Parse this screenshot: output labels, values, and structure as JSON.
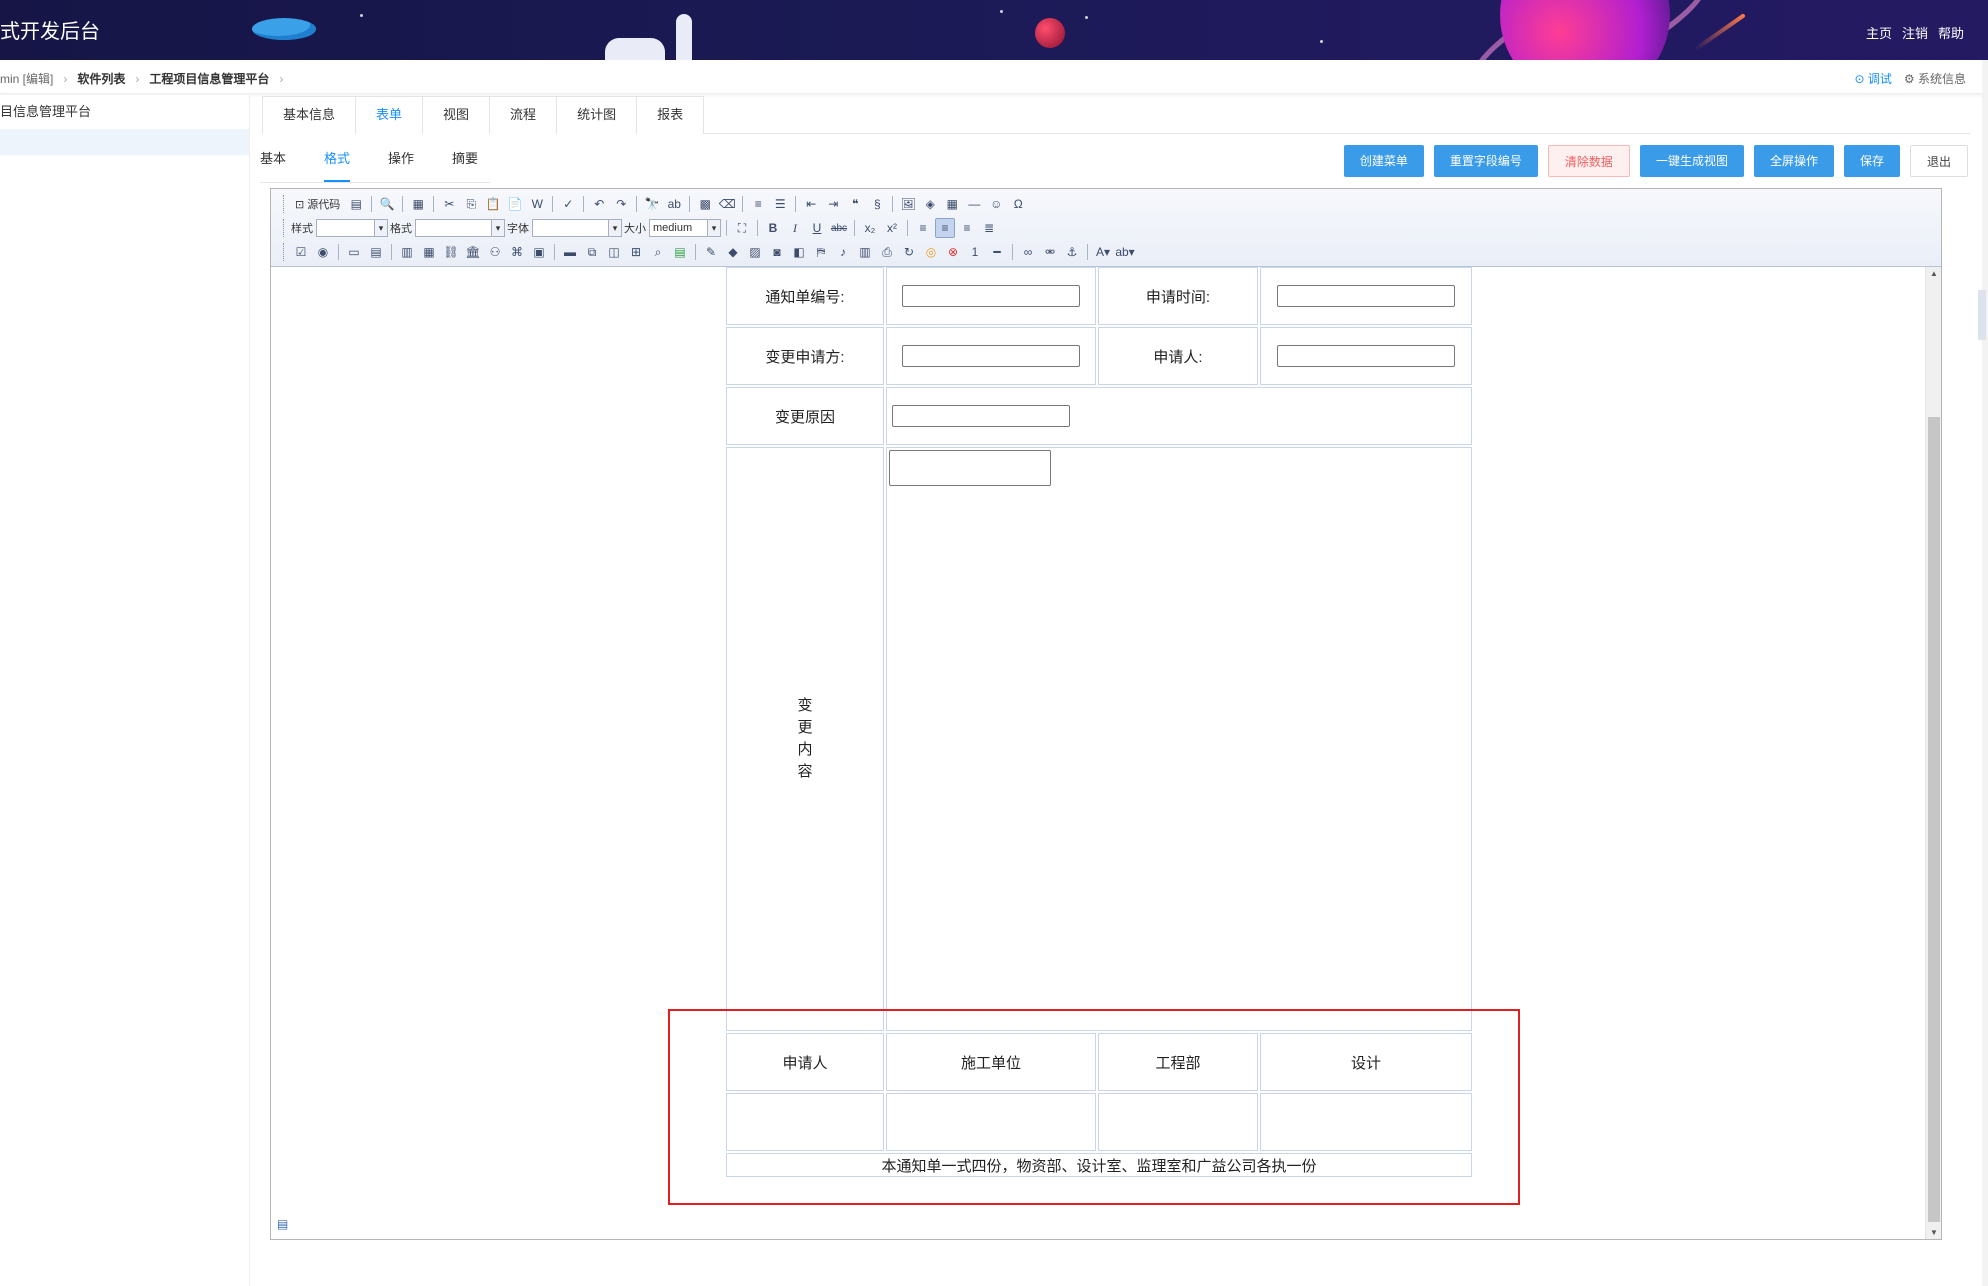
{
  "header": {
    "title": "式开发后台",
    "links": [
      "主页",
      "注销",
      "帮助"
    ]
  },
  "breadcrumb": {
    "user": "min [编辑]",
    "software_list": "软件列表",
    "platform": "工程项目信息管理平台",
    "debug": "⊙ 调试",
    "system_info": "⚙ 系统信息"
  },
  "sidebar": {
    "items": [
      {
        "label": "目信息管理平台"
      },
      {
        "label": ""
      }
    ]
  },
  "tabs": [
    {
      "label": "基本信息"
    },
    {
      "label": "表单"
    },
    {
      "label": "视图"
    },
    {
      "label": "流程"
    },
    {
      "label": "统计图"
    },
    {
      "label": "报表"
    }
  ],
  "subtabs": [
    {
      "label": "基本"
    },
    {
      "label": "格式"
    },
    {
      "label": "操作"
    },
    {
      "label": "摘要"
    }
  ],
  "actions": {
    "create_menu": "创建菜单",
    "reset_fields": "重置字段编号",
    "clear_data": "清除数据",
    "gen_view": "一键生成视图",
    "fullscreen": "全屏操作",
    "save": "保存",
    "exit": "退出"
  },
  "toolbar": {
    "source_code": "源代码",
    "style_label": "样式",
    "format_label": "格式",
    "font_label": "字体",
    "size_label": "大小",
    "size_value": "medium"
  },
  "form": {
    "notice_no": "通知单编号:",
    "apply_time": "申请时间:",
    "change_applicant_party": "变更申请方:",
    "applicant": "申请人:",
    "change_reason": "变更原因",
    "change_content": "变更内容",
    "sign_applicant": "申请人",
    "sign_contractor": "施工单位",
    "sign_engineering": "工程部",
    "sign_design": "设计",
    "footnote": "本通知单一式四份，物资部、设计室、监理室和广益公司各执一份"
  },
  "colors": {
    "header_bg": "#1b1a55",
    "accent": "#1890ff",
    "button": "#3a9be9",
    "highlight_box": "#e02020"
  }
}
